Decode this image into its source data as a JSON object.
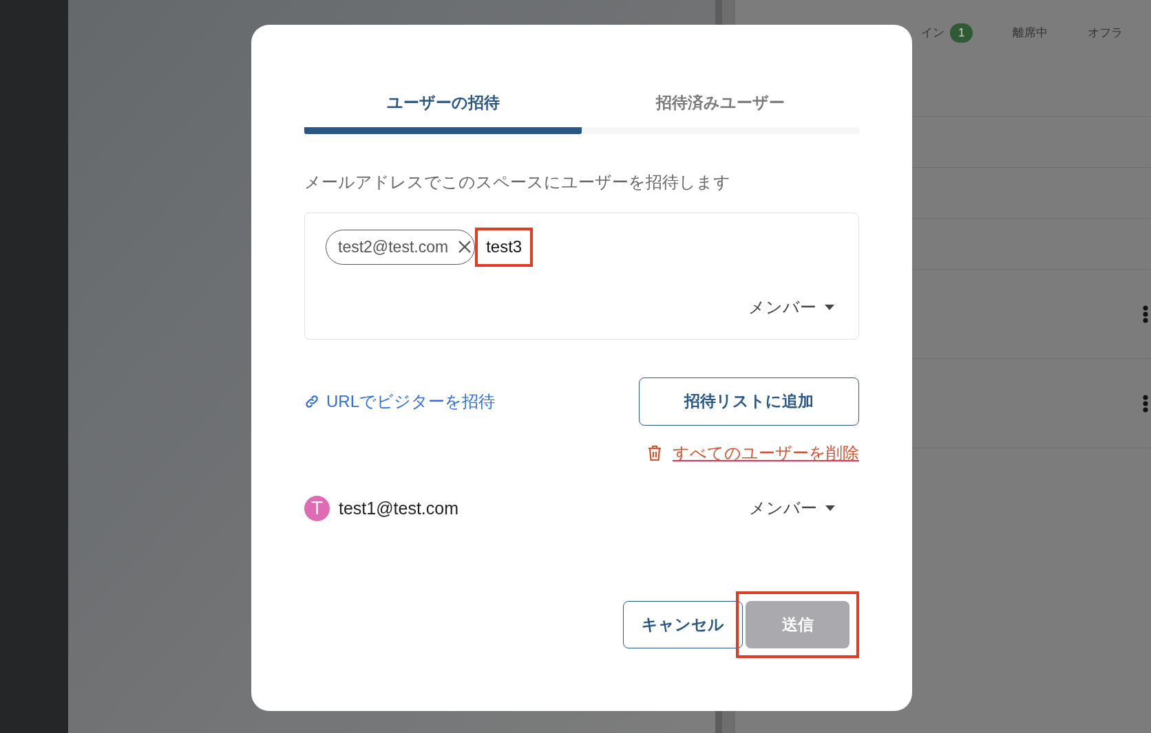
{
  "background": {
    "status_tabs": [
      {
        "label": "イン",
        "count": "1"
      },
      {
        "label": "離席中"
      },
      {
        "label": "オフラ"
      }
    ],
    "rows": [
      {
        "menu": false
      },
      {
        "menu": false
      },
      {
        "menu": false
      },
      {
        "menu": false
      },
      {
        "menu": true
      },
      {
        "menu": true
      }
    ]
  },
  "dialog": {
    "tabs": [
      {
        "label": "ユーザーの招待",
        "selected": true
      },
      {
        "label": "招待済みユーザー",
        "selected": false
      }
    ],
    "description": "メールアドレスでこのスペースにユーザーを招待します",
    "email_field": {
      "chips": [
        "test2@test.com"
      ],
      "value": "test3",
      "highlighted": true,
      "role": "メンバー"
    },
    "url_invite_link": "URLでビジターを招待",
    "add_button": "招待リストに追加",
    "delete_all_link": "すべてのユーザーを削除",
    "invitees": [
      {
        "initial": "T",
        "email": "test1@test.com",
        "color": "#e06bb5",
        "role": "メンバー"
      }
    ],
    "cancel_button": "キャンセル",
    "send_button": {
      "label": "送信",
      "disabled": true,
      "highlighted": true
    }
  }
}
